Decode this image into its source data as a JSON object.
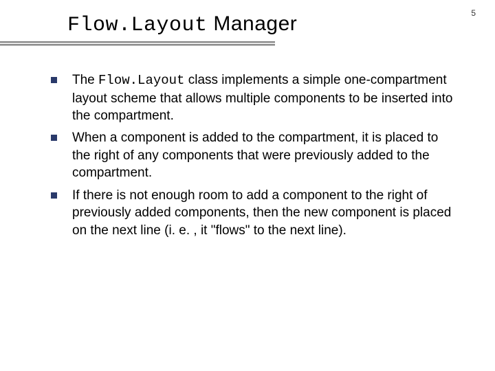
{
  "page_number": "5",
  "title": {
    "mono": "Flow.Layout",
    "rest": " Manager"
  },
  "bullets": [
    {
      "pre": "The ",
      "mono": "Flow.Layout",
      "post": " class implements a simple one-compartment layout scheme that allows multiple components to be inserted into the compartment."
    },
    {
      "pre": "When a component is added to the compartment, it is placed to the right of any components that were previously added to the compartment.",
      "mono": "",
      "post": ""
    },
    {
      "pre": "If there is not enough room to add a component to the right of previously added components, then the new component is placed on the next line (i. e. , it \"flows\" to the next line).",
      "mono": "",
      "post": ""
    }
  ]
}
